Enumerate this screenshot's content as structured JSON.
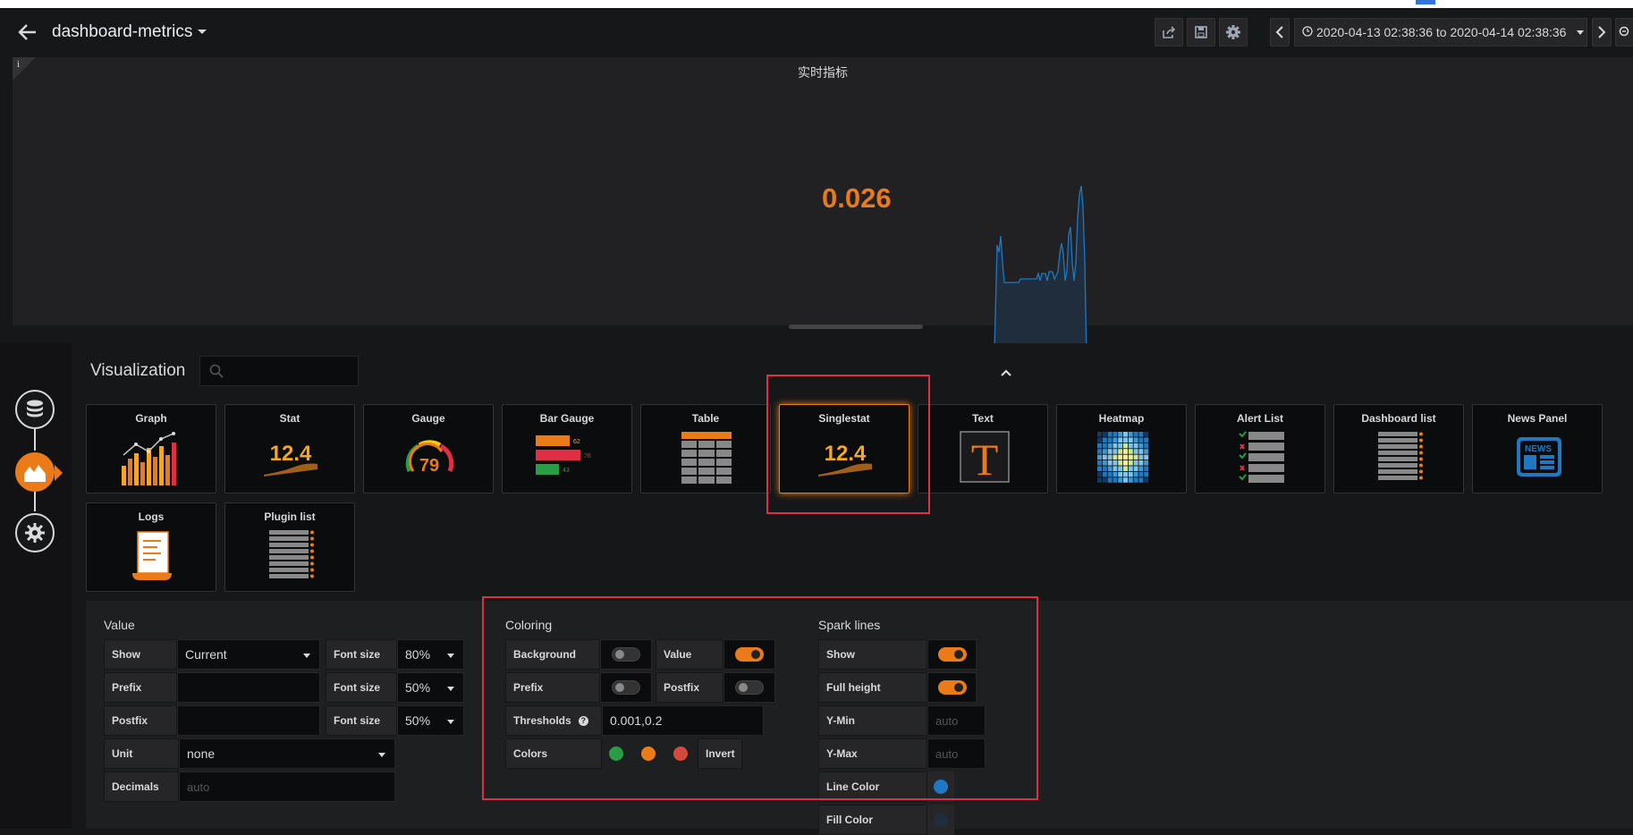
{
  "header": {
    "dashboard_title": "dashboard-metrics",
    "time_range": "2020-04-13 02:38:36 to 2020-04-14 02:38:36"
  },
  "panel": {
    "title": "实时指标",
    "info": "i",
    "value": "0.026"
  },
  "visualization": {
    "title": "Visualization",
    "search_placeholder": "",
    "cards": [
      {
        "name": "Graph"
      },
      {
        "name": "Stat"
      },
      {
        "name": "Gauge"
      },
      {
        "name": "Bar Gauge"
      },
      {
        "name": "Table"
      },
      {
        "name": "Singlestat"
      },
      {
        "name": "Text"
      },
      {
        "name": "Heatmap"
      },
      {
        "name": "Alert List"
      },
      {
        "name": "Dashboard list"
      },
      {
        "name": "News Panel"
      },
      {
        "name": "Logs"
      },
      {
        "name": "Plugin list"
      }
    ],
    "icon_texts": {
      "stat": "12.4",
      "gauge": "79",
      "bar_gauge_values": [
        "62",
        "76",
        "43"
      ],
      "singlestat": "12.4",
      "text": "T",
      "news": "NEWS"
    }
  },
  "value_section": {
    "title": "Value",
    "show_label": "Show",
    "show_value": "Current",
    "prefix_label": "Prefix",
    "postfix_label": "Postfix",
    "font_size_label": "Font size",
    "font_size_1": "80%",
    "font_size_2": "50%",
    "font_size_3": "50%",
    "unit_label": "Unit",
    "unit_value": "none",
    "decimals_label": "Decimals",
    "decimals_placeholder": "auto"
  },
  "coloring_section": {
    "title": "Coloring",
    "background_label": "Background",
    "value_label": "Value",
    "prefix_label": "Prefix",
    "postfix_label": "Postfix",
    "thresholds_label": "Thresholds",
    "thresholds_value": "0.001,0.2",
    "colors_label": "Colors",
    "invert_label": "Invert",
    "colors": [
      "#299c46",
      "#eb7b18",
      "#d44a3a"
    ]
  },
  "sparklines_section": {
    "title": "Spark lines",
    "show_label": "Show",
    "full_height_label": "Full height",
    "ymin_label": "Y-Min",
    "ymin_placeholder": "auto",
    "ymax_label": "Y-Max",
    "ymax_placeholder": "auto",
    "line_color_label": "Line Color",
    "fill_color_label": "Fill Color",
    "line_color": "#1f78c1",
    "fill_color": "#1f2d3d"
  },
  "colors": {
    "accent": "#eb7b18",
    "highlight_box": "#e02f44"
  }
}
